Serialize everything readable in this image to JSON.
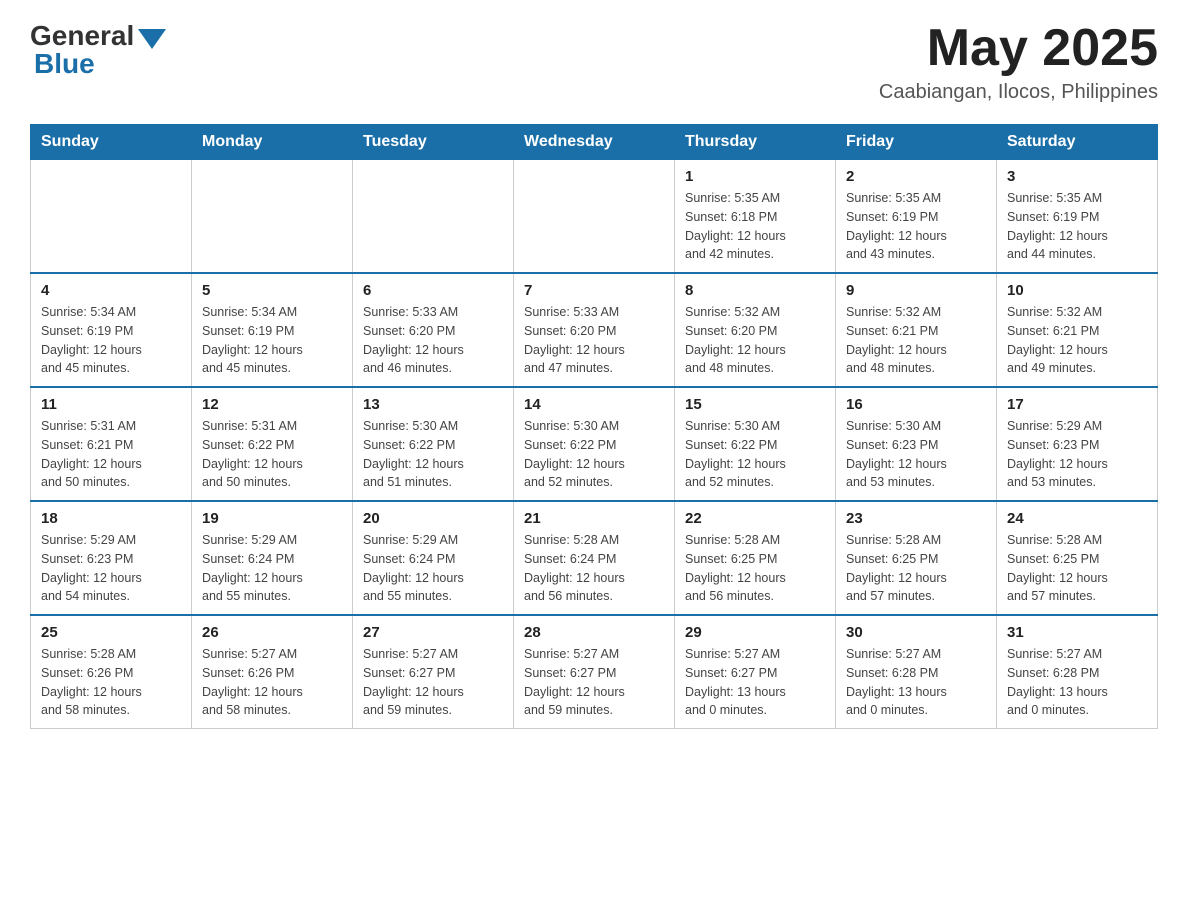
{
  "header": {
    "logo_general": "General",
    "logo_blue": "Blue",
    "month_title": "May 2025",
    "subtitle": "Caabiangan, Ilocos, Philippines"
  },
  "days_of_week": [
    "Sunday",
    "Monday",
    "Tuesday",
    "Wednesday",
    "Thursday",
    "Friday",
    "Saturday"
  ],
  "weeks": [
    {
      "days": [
        {
          "number": "",
          "info": ""
        },
        {
          "number": "",
          "info": ""
        },
        {
          "number": "",
          "info": ""
        },
        {
          "number": "",
          "info": ""
        },
        {
          "number": "1",
          "info": "Sunrise: 5:35 AM\nSunset: 6:18 PM\nDaylight: 12 hours\nand 42 minutes."
        },
        {
          "number": "2",
          "info": "Sunrise: 5:35 AM\nSunset: 6:19 PM\nDaylight: 12 hours\nand 43 minutes."
        },
        {
          "number": "3",
          "info": "Sunrise: 5:35 AM\nSunset: 6:19 PM\nDaylight: 12 hours\nand 44 minutes."
        }
      ]
    },
    {
      "days": [
        {
          "number": "4",
          "info": "Sunrise: 5:34 AM\nSunset: 6:19 PM\nDaylight: 12 hours\nand 45 minutes."
        },
        {
          "number": "5",
          "info": "Sunrise: 5:34 AM\nSunset: 6:19 PM\nDaylight: 12 hours\nand 45 minutes."
        },
        {
          "number": "6",
          "info": "Sunrise: 5:33 AM\nSunset: 6:20 PM\nDaylight: 12 hours\nand 46 minutes."
        },
        {
          "number": "7",
          "info": "Sunrise: 5:33 AM\nSunset: 6:20 PM\nDaylight: 12 hours\nand 47 minutes."
        },
        {
          "number": "8",
          "info": "Sunrise: 5:32 AM\nSunset: 6:20 PM\nDaylight: 12 hours\nand 48 minutes."
        },
        {
          "number": "9",
          "info": "Sunrise: 5:32 AM\nSunset: 6:21 PM\nDaylight: 12 hours\nand 48 minutes."
        },
        {
          "number": "10",
          "info": "Sunrise: 5:32 AM\nSunset: 6:21 PM\nDaylight: 12 hours\nand 49 minutes."
        }
      ]
    },
    {
      "days": [
        {
          "number": "11",
          "info": "Sunrise: 5:31 AM\nSunset: 6:21 PM\nDaylight: 12 hours\nand 50 minutes."
        },
        {
          "number": "12",
          "info": "Sunrise: 5:31 AM\nSunset: 6:22 PM\nDaylight: 12 hours\nand 50 minutes."
        },
        {
          "number": "13",
          "info": "Sunrise: 5:30 AM\nSunset: 6:22 PM\nDaylight: 12 hours\nand 51 minutes."
        },
        {
          "number": "14",
          "info": "Sunrise: 5:30 AM\nSunset: 6:22 PM\nDaylight: 12 hours\nand 52 minutes."
        },
        {
          "number": "15",
          "info": "Sunrise: 5:30 AM\nSunset: 6:22 PM\nDaylight: 12 hours\nand 52 minutes."
        },
        {
          "number": "16",
          "info": "Sunrise: 5:30 AM\nSunset: 6:23 PM\nDaylight: 12 hours\nand 53 minutes."
        },
        {
          "number": "17",
          "info": "Sunrise: 5:29 AM\nSunset: 6:23 PM\nDaylight: 12 hours\nand 53 minutes."
        }
      ]
    },
    {
      "days": [
        {
          "number": "18",
          "info": "Sunrise: 5:29 AM\nSunset: 6:23 PM\nDaylight: 12 hours\nand 54 minutes."
        },
        {
          "number": "19",
          "info": "Sunrise: 5:29 AM\nSunset: 6:24 PM\nDaylight: 12 hours\nand 55 minutes."
        },
        {
          "number": "20",
          "info": "Sunrise: 5:29 AM\nSunset: 6:24 PM\nDaylight: 12 hours\nand 55 minutes."
        },
        {
          "number": "21",
          "info": "Sunrise: 5:28 AM\nSunset: 6:24 PM\nDaylight: 12 hours\nand 56 minutes."
        },
        {
          "number": "22",
          "info": "Sunrise: 5:28 AM\nSunset: 6:25 PM\nDaylight: 12 hours\nand 56 minutes."
        },
        {
          "number": "23",
          "info": "Sunrise: 5:28 AM\nSunset: 6:25 PM\nDaylight: 12 hours\nand 57 minutes."
        },
        {
          "number": "24",
          "info": "Sunrise: 5:28 AM\nSunset: 6:25 PM\nDaylight: 12 hours\nand 57 minutes."
        }
      ]
    },
    {
      "days": [
        {
          "number": "25",
          "info": "Sunrise: 5:28 AM\nSunset: 6:26 PM\nDaylight: 12 hours\nand 58 minutes."
        },
        {
          "number": "26",
          "info": "Sunrise: 5:27 AM\nSunset: 6:26 PM\nDaylight: 12 hours\nand 58 minutes."
        },
        {
          "number": "27",
          "info": "Sunrise: 5:27 AM\nSunset: 6:27 PM\nDaylight: 12 hours\nand 59 minutes."
        },
        {
          "number": "28",
          "info": "Sunrise: 5:27 AM\nSunset: 6:27 PM\nDaylight: 12 hours\nand 59 minutes."
        },
        {
          "number": "29",
          "info": "Sunrise: 5:27 AM\nSunset: 6:27 PM\nDaylight: 13 hours\nand 0 minutes."
        },
        {
          "number": "30",
          "info": "Sunrise: 5:27 AM\nSunset: 6:28 PM\nDaylight: 13 hours\nand 0 minutes."
        },
        {
          "number": "31",
          "info": "Sunrise: 5:27 AM\nSunset: 6:28 PM\nDaylight: 13 hours\nand 0 minutes."
        }
      ]
    }
  ]
}
